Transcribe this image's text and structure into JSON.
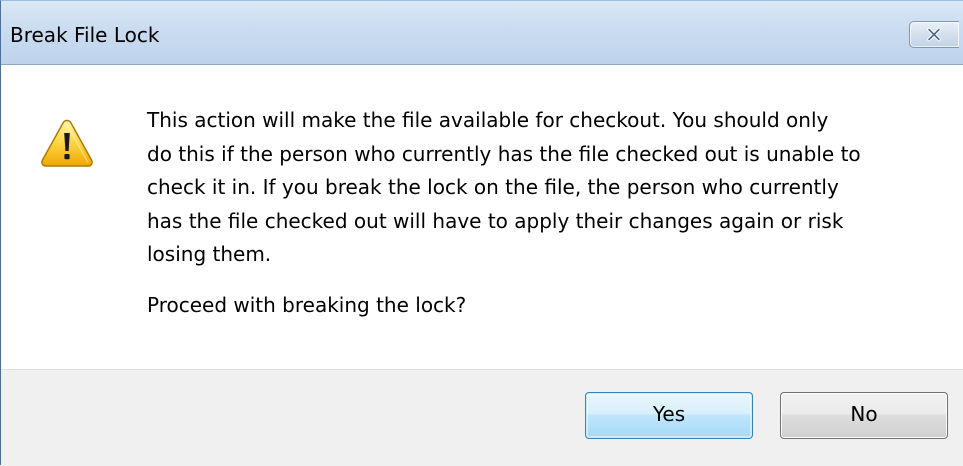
{
  "dialog": {
    "title": "Break File Lock",
    "close_icon": "close-icon",
    "warning_icon": "warning-icon",
    "message": "This action will make the file available for checkout.  You should only\ndo this if the person who currently has the file checked out is unable to\ncheck it in. If you break the lock on the file, the person who currently\nhas the file checked out will have to apply their changes again or risk\nlosing them.",
    "question": "Proceed with breaking the lock?",
    "buttons": {
      "yes_label": "Yes",
      "no_label": "No"
    }
  }
}
